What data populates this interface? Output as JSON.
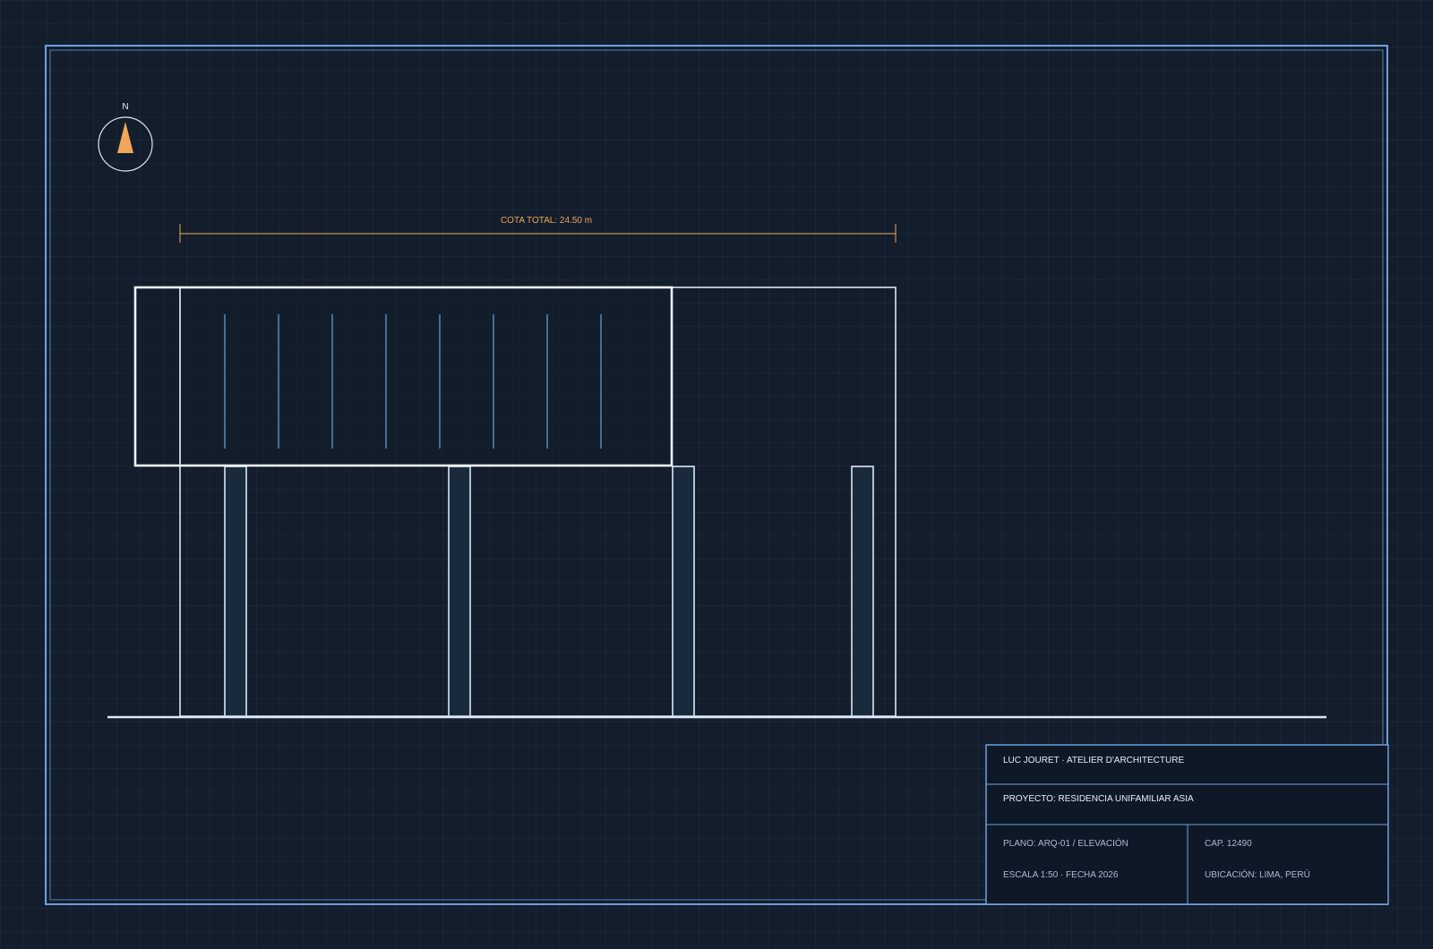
{
  "north": {
    "label": "N",
    "icon": "north-arrow-icon"
  },
  "dimension": {
    "label": "COTA TOTAL: 24.50 m"
  },
  "title_block": {
    "studio": "LUC JOURET · ATELIER D'ARCHITECTURE",
    "project": "PROYECTO: RESIDENCIA UNIFAMILIAR ASIA",
    "plan": "PLANO: ARQ-01 / ELEVACIÓN",
    "scale_date": "ESCALA 1:50 · FECHA 2026",
    "cap": "CAP. 12490",
    "location": "UBICACIÓN: LIMA, PERÚ"
  },
  "colors": {
    "background": "#131d2b",
    "grid": "#1f3044",
    "frame": "#6f9fe0",
    "drawing": "#dbe7f5",
    "accent": "#f2a65a",
    "column_fill": "#1a2a3d",
    "title_block_fill": "#0f1826"
  }
}
